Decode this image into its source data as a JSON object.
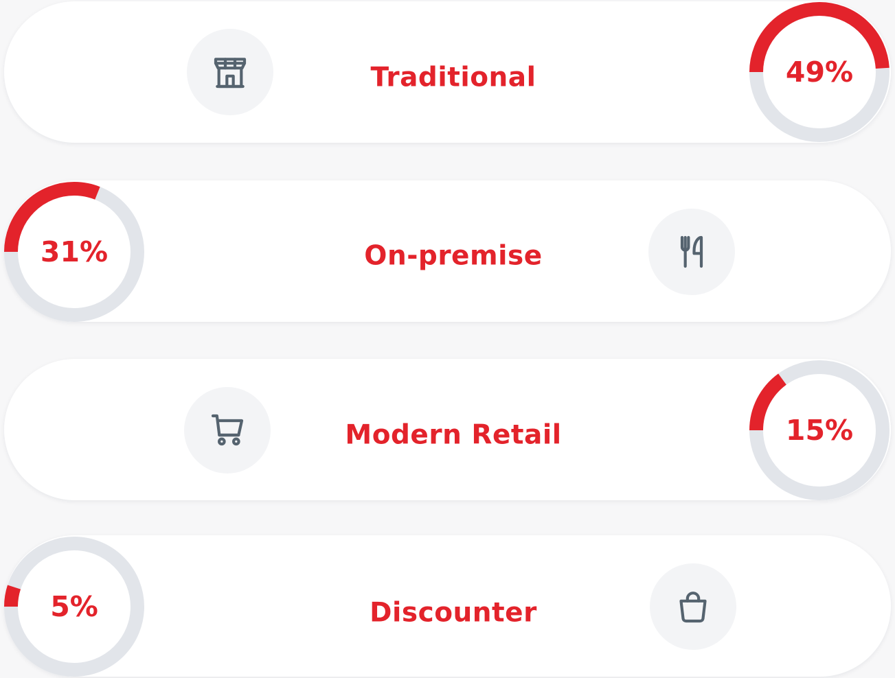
{
  "theme": {
    "accent": "#e3232b",
    "track": "#e2e5ea",
    "icon": "#55636f",
    "card": "#ffffff",
    "background": "#f7f7f8"
  },
  "chart_data": {
    "type": "bar",
    "categories": [
      "Traditional",
      "On-premise",
      "Modern Retail",
      "Discounter"
    ],
    "values": [
      49,
      31,
      15,
      5
    ],
    "unit": "%"
  },
  "rows": [
    {
      "label": "Traditional",
      "value": 49,
      "value_text": "49%",
      "icon": "storefront-icon"
    },
    {
      "label": "On-premise",
      "value": 31,
      "value_text": "31%",
      "icon": "fork-knife-icon"
    },
    {
      "label": "Modern Retail",
      "value": 15,
      "value_text": "15%",
      "icon": "shopping-cart-icon"
    },
    {
      "label": "Discounter",
      "value": 5,
      "value_text": "5%",
      "icon": "shopping-bag-icon"
    }
  ]
}
